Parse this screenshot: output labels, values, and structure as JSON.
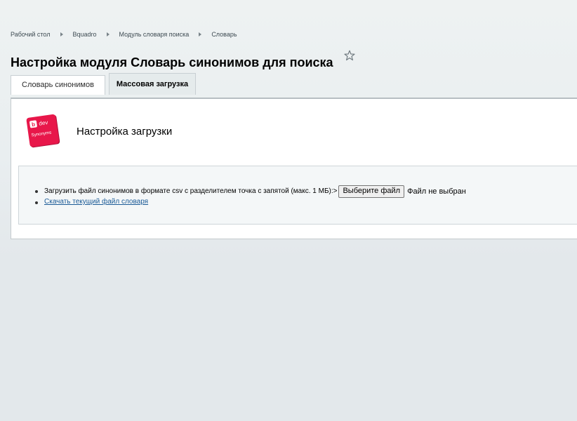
{
  "breadcrumb": [
    "Рабочий стол",
    "Bquadro",
    "Модуль словаря поиска",
    "Словарь"
  ],
  "page_title": "Настройка модуля Словарь синонимов для поиска",
  "tabs": [
    {
      "label": "Словарь синонимов",
      "active": false
    },
    {
      "label": "Массовая загрузка",
      "active": true
    }
  ],
  "logo": {
    "badge": "b",
    "line1": "dev",
    "line2": "Synonyms",
    "color": "#e8174a"
  },
  "section": {
    "title": "Настройка загрузки"
  },
  "upload": {
    "label": "Загрузить файл синонимов в формате csv с разделителем точка с запятой (макс. 1 МБ):>",
    "button": "Выберите файл",
    "status": "Файл не выбран"
  },
  "download_link": "Скачать текущий файл словаря",
  "icons": {
    "favorite": "star-icon",
    "nav_separator": "triangle-right-icon"
  }
}
